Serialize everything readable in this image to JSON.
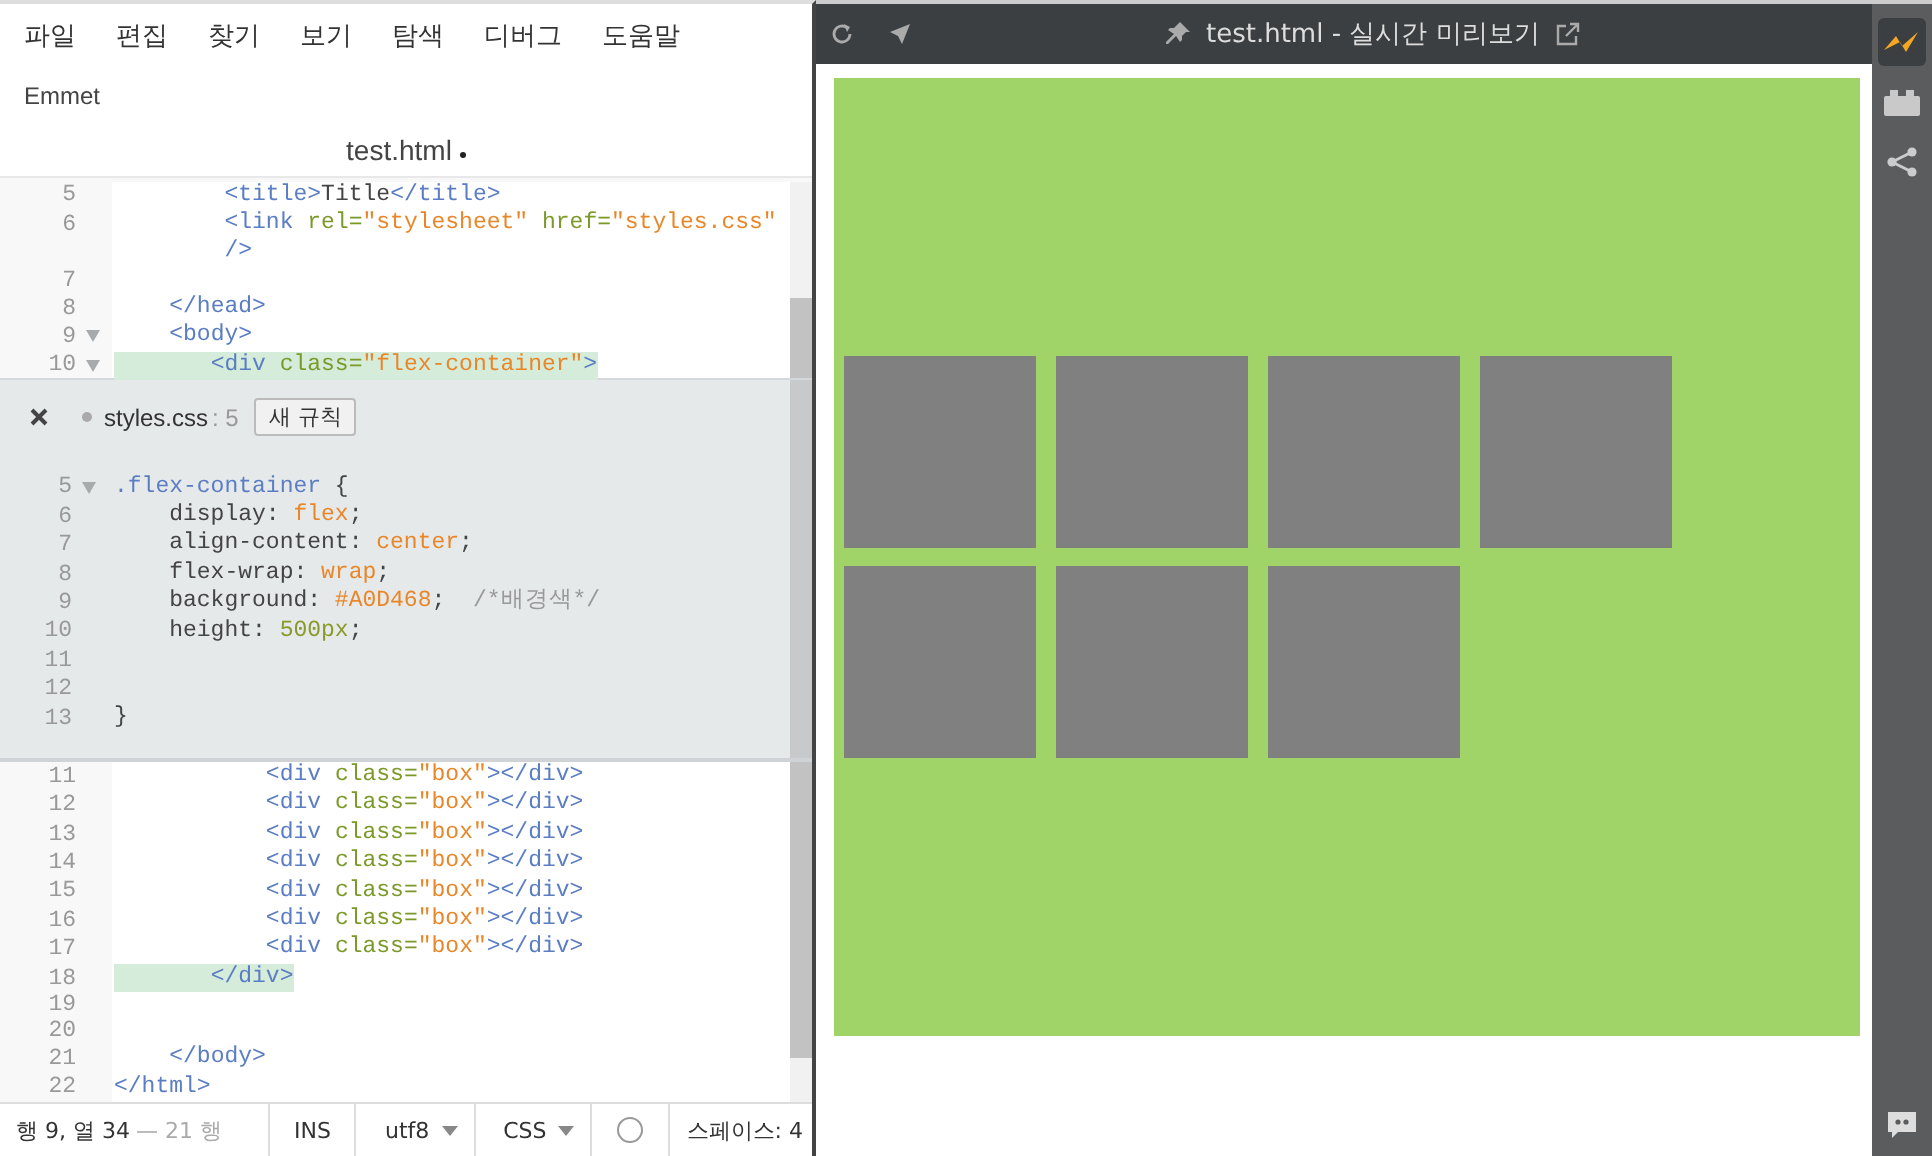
{
  "menu": [
    {
      "label": "파일"
    },
    {
      "label": "편집"
    },
    {
      "label": "찾기"
    },
    {
      "label": "보기"
    },
    {
      "label": "탐색"
    },
    {
      "label": "디버그"
    },
    {
      "label": "도움말"
    }
  ],
  "menu2": [
    {
      "label": "Emmet"
    }
  ],
  "editor": {
    "title": "test.html",
    "modified": true,
    "top_lines": [
      {
        "num": "5",
        "fold": false,
        "highlight": false,
        "text": "        <title>Title</title>"
      },
      {
        "num": "6",
        "fold": false,
        "highlight": false,
        "text": "        <link rel=\"stylesheet\" href=\"styles.css\""
      },
      {
        "fold": false,
        "highlight": false,
        "text": "        />"
      },
      {
        "num": "7",
        "fold": false,
        "highlight": false
      },
      {
        "num": "8",
        "fold": false,
        "highlight": false,
        "text": "    </head>"
      },
      {
        "num": "9",
        "fold": true,
        "highlight": false,
        "text": "    <body>"
      },
      {
        "num": "10",
        "fold": true,
        "highlight": true,
        "text": "       <div class=\"flex-container\">"
      }
    ],
    "inline": {
      "file": "styles.css",
      "line": ": 5",
      "button": "새 규칙",
      "lines": [
        {
          "num": "5",
          "fold": true,
          "text": ".flex-container {"
        },
        {
          "num": "6",
          "fold": false,
          "text": "    display: flex;"
        },
        {
          "num": "7",
          "fold": false,
          "text": "    align-content: center;"
        },
        {
          "num": "8",
          "fold": false,
          "text": "    flex-wrap: wrap;"
        },
        {
          "num": "9",
          "fold": false,
          "text": "    background: #A0D468;  /*배경색*/"
        },
        {
          "num": "10",
          "fold": false,
          "text": "    height: 500px;"
        },
        {
          "num": "11",
          "fold": false
        },
        {
          "num": "12",
          "fold": false
        },
        {
          "num": "13",
          "fold": false,
          "text": "}"
        }
      ]
    },
    "bottom_lines": [
      {
        "num": "11",
        "fold": false,
        "highlight": false,
        "text": "           <div class=\"box\"></div>"
      },
      {
        "num": "12",
        "fold": false,
        "highlight": false,
        "text": "           <div class=\"box\"></div>"
      },
      {
        "num": "13",
        "fold": false,
        "highlight": false,
        "text": "           <div class=\"box\"></div>"
      },
      {
        "num": "14",
        "fold": false,
        "highlight": false,
        "text": "           <div class=\"box\"></div>"
      },
      {
        "num": "15",
        "fold": false,
        "highlight": false,
        "text": "           <div class=\"box\"></div>"
      },
      {
        "num": "16",
        "fold": false,
        "highlight": false,
        "text": "           <div class=\"box\"></div>"
      },
      {
        "num": "17",
        "fold": false,
        "highlight": false,
        "text": "           <div class=\"box\"></div>"
      },
      {
        "num": "18",
        "fold": false,
        "highlight": true,
        "text": "       </div>"
      },
      {
        "num": "19",
        "fold": false,
        "highlight": false
      },
      {
        "num": "20",
        "fold": false,
        "highlight": false
      },
      {
        "num": "21",
        "fold": false,
        "highlight": false,
        "text": "    </body>"
      },
      {
        "num": "22",
        "fold": false,
        "highlight": false,
        "text": "</html>"
      }
    ]
  },
  "status_bar": {
    "position": "행 9, 열 34",
    "lines": "— 21 행",
    "mode": "INS",
    "encoding": "utf8",
    "language": "CSS",
    "indent": "스페이스: 4"
  },
  "preview": {
    "title": "test.html - 실시간 미리보기",
    "boxes": [
      {
        "kind": "box"
      },
      {
        "kind": "box"
      },
      {
        "kind": "box"
      },
      {
        "kind": "box"
      },
      {
        "kind": "box"
      },
      {
        "kind": "box"
      },
      {
        "kind": "box"
      }
    ]
  },
  "sidebar": [
    {
      "kind": "live",
      "selected": true
    },
    {
      "kind": "extensions",
      "selected": false
    },
    {
      "kind": "share",
      "selected": false
    }
  ]
}
